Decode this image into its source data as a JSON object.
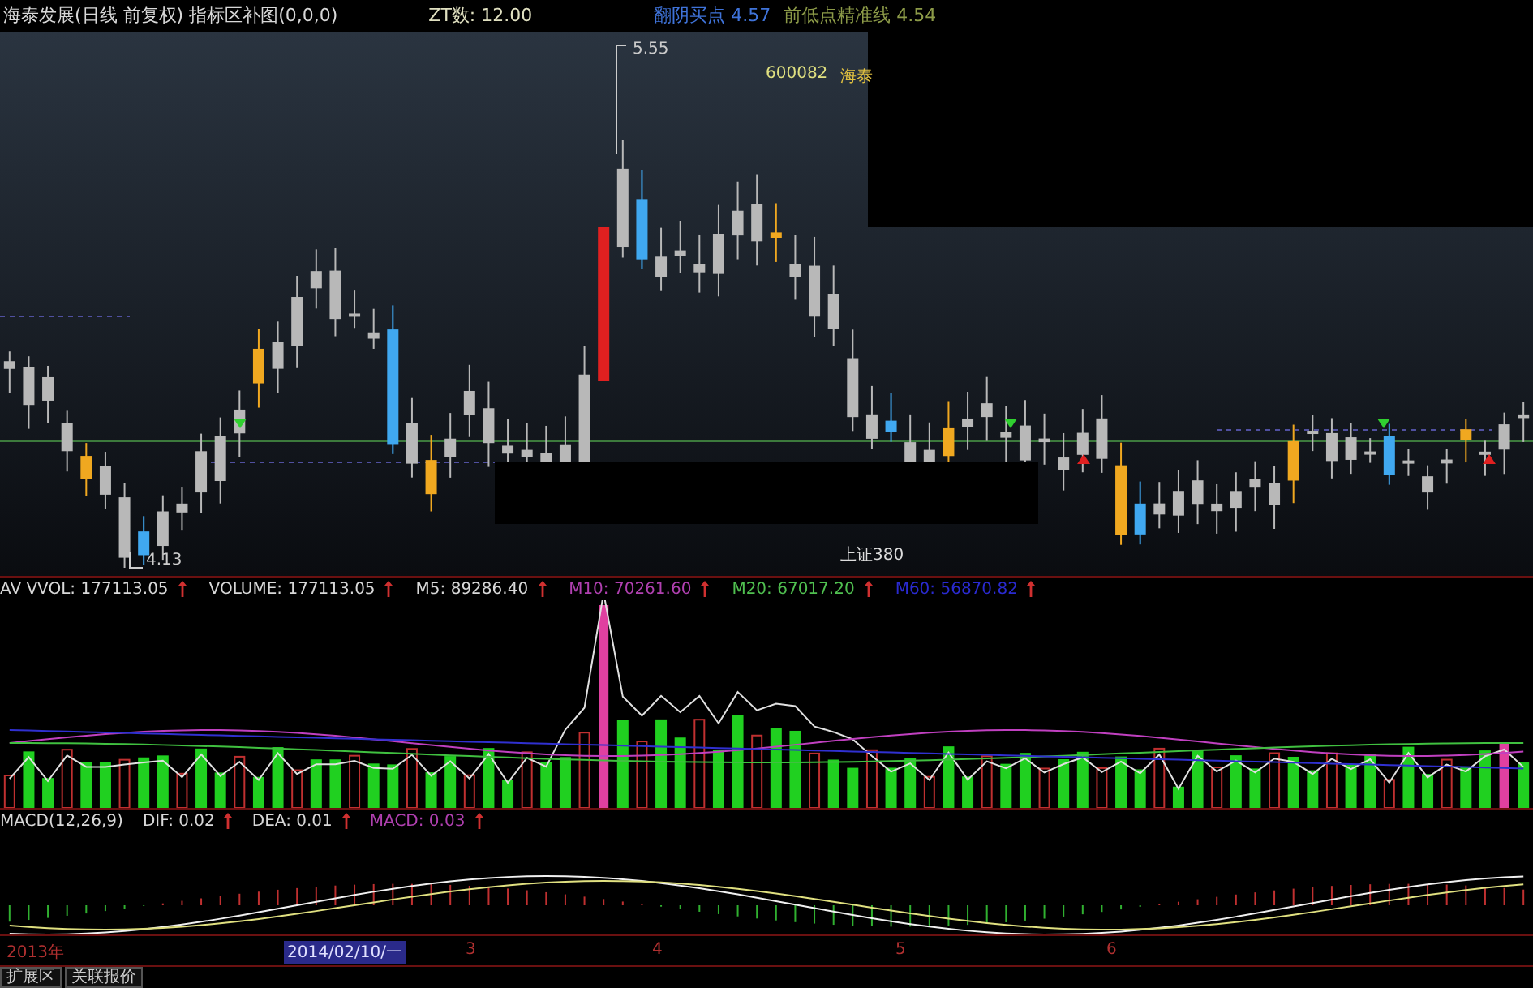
{
  "header": {
    "title": "海泰发展(日线 前复权) 指标区补图(0,0,0)",
    "zt": "ZT数: 12.00",
    "indicators": [
      {
        "label": "翻阴买点",
        "value": "4.57",
        "color": "#3f73d9"
      },
      {
        "label": "前低点精准线",
        "value": "4.54",
        "color": "#8c9a48"
      }
    ]
  },
  "price_chart": {
    "labels": [
      {
        "kind": "high",
        "text": "5.55"
      },
      {
        "kind": "code",
        "text": "600082"
      },
      {
        "kind": "name",
        "text": "海泰"
      },
      {
        "kind": "low",
        "text": "4.13"
      },
      {
        "kind": "index",
        "text": "上证380"
      }
    ]
  },
  "volume": {
    "title": "AV VVOL: 177113.05",
    "indicators": [
      {
        "text": "VOLUME: 177113.05",
        "color": "#d8d8d8"
      },
      {
        "text": "M5: 89286.40",
        "color": "#d8d8d8"
      },
      {
        "text": "M10: 70261.60",
        "color": "#b040b0"
      },
      {
        "text": "M20: 67017.20",
        "color": "#50c050"
      },
      {
        "text": "M60: 56870.82",
        "color": "#2a2ad0"
      }
    ]
  },
  "macd": {
    "title": "MACD(12,26,9)",
    "indicators": [
      {
        "text": "DIF: 0.02",
        "color": "#d8d8d8"
      },
      {
        "text": "DEA: 0.01",
        "color": "#d8d8d8"
      },
      {
        "text": "MACD: 0.03",
        "color": "#b040b0"
      }
    ]
  },
  "time_axis": {
    "labels": [
      {
        "text": "2013年",
        "selected": false
      },
      {
        "text": "2014/02/10/一",
        "selected": true
      },
      {
        "text": "3",
        "selected": false
      },
      {
        "text": "4",
        "selected": false
      },
      {
        "text": "5",
        "selected": false
      },
      {
        "text": "6",
        "selected": false
      }
    ]
  },
  "tabs": [
    {
      "label": "扩展区"
    },
    {
      "label": "关联报价"
    }
  ]
}
